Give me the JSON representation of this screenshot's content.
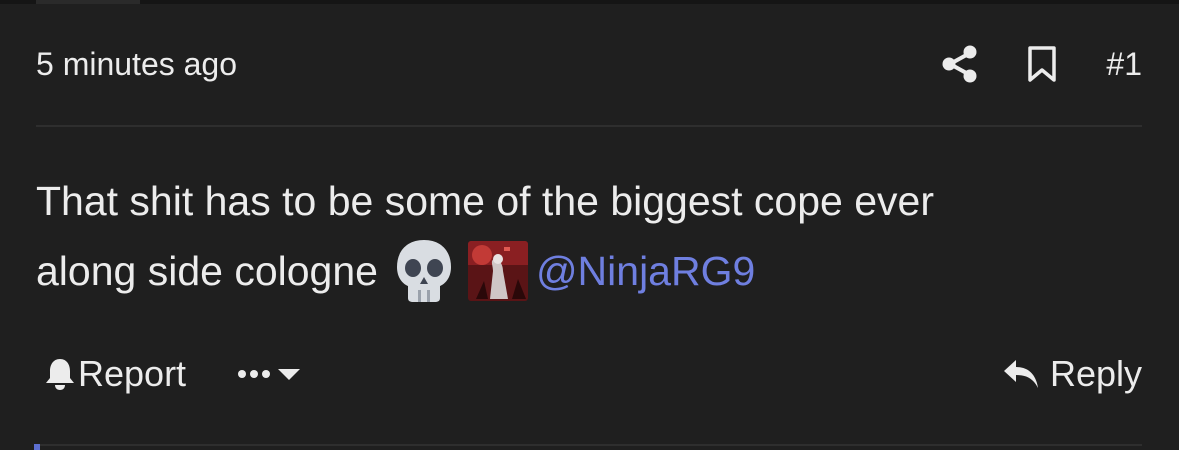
{
  "post": {
    "timestamp": "5 minutes ago",
    "number": "#1",
    "body": {
      "line1": "That shit has to be some of the biggest cope ever",
      "line2": "along side cologne",
      "emoji": "skull-emoji",
      "mention": "@NinjaRG9"
    },
    "actions": {
      "share_icon": "share-icon",
      "bookmark_icon": "bookmark-icon",
      "report_label": "Report",
      "report_icon": "bell-icon",
      "more_icon": "ellipsis-icon",
      "dropdown_icon": "caret-down-icon",
      "reply_label": "Reply",
      "reply_icon": "reply-arrow-icon"
    }
  },
  "colors": {
    "background": "#1f1f1f",
    "text": "#ececec",
    "mention": "#6f7fe0",
    "divider": "#2e2e2e"
  }
}
